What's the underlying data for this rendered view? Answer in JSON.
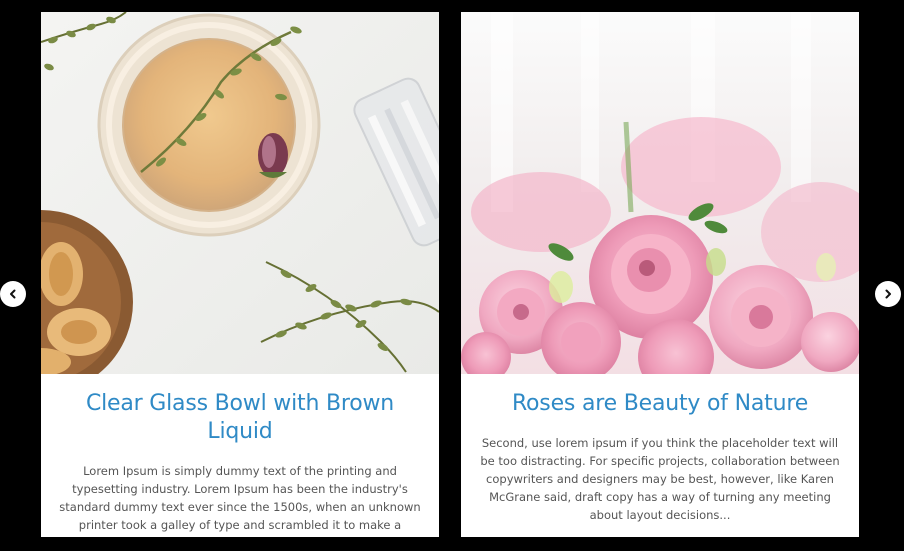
{
  "carousel": {
    "prev_icon": "chevron-left-icon",
    "next_icon": "chevron-right-icon",
    "cards": [
      {
        "title": "Clear Glass Bowl with Brown Liquid",
        "text": "Lorem Ipsum is simply dummy text of the printing and typesetting industry. Lorem Ipsum has been the industry's standard dummy text ever since the 1500s, when an unknown printer took a galley of type and scrambled it to make a type...",
        "image": "tea-with-thyme-photo"
      },
      {
        "title": "Roses are Beauty of Nature",
        "text": "Second, use lorem ipsum if you think the placeholder text will be too distracting. For specific projects, collaboration between copywriters and designers may be best, however, like Karen McGrane said, draft copy has a way of turning any meeting about layout decisions...",
        "image": "pink-roses-photo"
      }
    ]
  },
  "colors": {
    "background": "#000000",
    "card": "#ffffff",
    "title": "#2f8ac6",
    "text": "#555555"
  }
}
